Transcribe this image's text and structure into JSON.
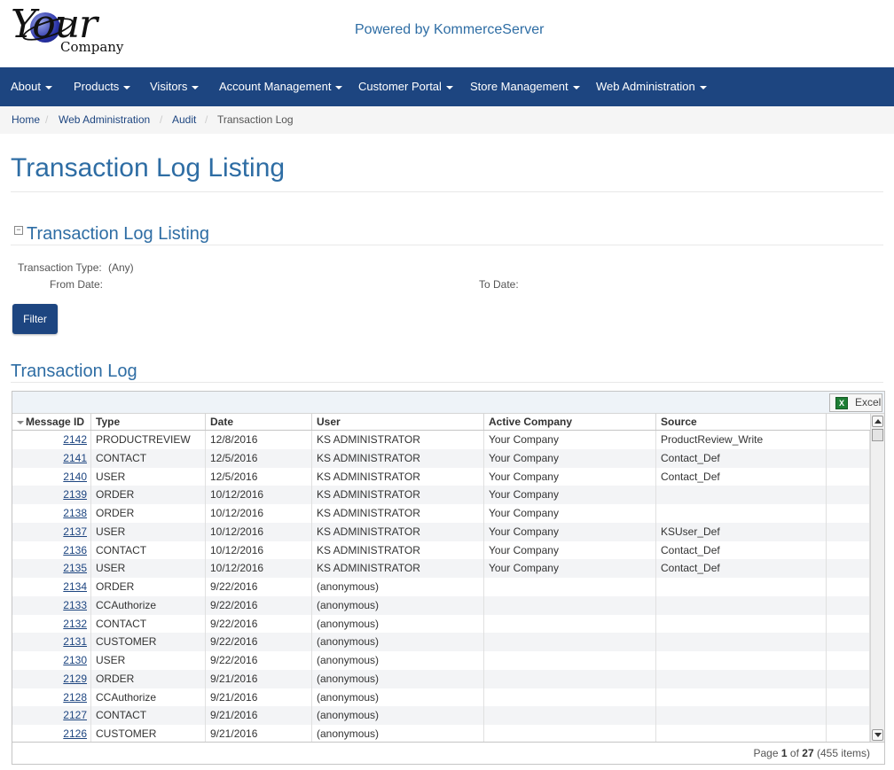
{
  "header": {
    "logo_text": "Your Company",
    "logo_your": "Your",
    "logo_company": "Company",
    "powered_by": "Powered by KommerceServer"
  },
  "nav": {
    "items": [
      {
        "label": "About"
      },
      {
        "label": "Products"
      },
      {
        "label": "Visitors"
      },
      {
        "label": "Account Management"
      },
      {
        "label": "Customer Portal"
      },
      {
        "label": "Store Management"
      },
      {
        "label": "Web Administration"
      }
    ]
  },
  "breadcrumb": {
    "home": "Home",
    "web_admin": "Web Administration",
    "audit": "Audit",
    "current": "Transaction Log",
    "separator": "/"
  },
  "page": {
    "title": "Transaction Log Listing",
    "section_title": "Transaction Log Listing",
    "collapse_glyph": "−"
  },
  "filters": {
    "type_label": "Transaction Type:",
    "type_value": "(Any)",
    "from_label": "From Date:",
    "to_label": "To Date:",
    "filter_button": "Filter"
  },
  "grid": {
    "title": "Transaction Log",
    "excel_label": "Excel",
    "excel_icon": "X",
    "columns": [
      "Message ID",
      "Type",
      "Date",
      "User",
      "Active Company",
      "Source"
    ],
    "rows": [
      [
        "2142",
        "PRODUCTREVIEW",
        "12/8/2016",
        "KS ADMINISTRATOR",
        "Your Company",
        "ProductReview_Write"
      ],
      [
        "2141",
        "CONTACT",
        "12/5/2016",
        "KS ADMINISTRATOR",
        "Your Company",
        "Contact_Def"
      ],
      [
        "2140",
        "USER",
        "12/5/2016",
        "KS ADMINISTRATOR",
        "Your Company",
        "Contact_Def"
      ],
      [
        "2139",
        "ORDER",
        "10/12/2016",
        "KS ADMINISTRATOR",
        "Your Company",
        ""
      ],
      [
        "2138",
        "ORDER",
        "10/12/2016",
        "KS ADMINISTRATOR",
        "Your Company",
        ""
      ],
      [
        "2137",
        "USER",
        "10/12/2016",
        "KS ADMINISTRATOR",
        "Your Company",
        "KSUser_Def"
      ],
      [
        "2136",
        "CONTACT",
        "10/12/2016",
        "KS ADMINISTRATOR",
        "Your Company",
        "Contact_Def"
      ],
      [
        "2135",
        "USER",
        "10/12/2016",
        "KS ADMINISTRATOR",
        "Your Company",
        "Contact_Def"
      ],
      [
        "2134",
        "ORDER",
        "9/22/2016",
        "(anonymous)",
        "",
        ""
      ],
      [
        "2133",
        "CCAuthorize",
        "9/22/2016",
        "(anonymous)",
        "",
        ""
      ],
      [
        "2132",
        "CONTACT",
        "9/22/2016",
        "(anonymous)",
        "",
        ""
      ],
      [
        "2131",
        "CUSTOMER",
        "9/22/2016",
        "(anonymous)",
        "",
        ""
      ],
      [
        "2130",
        "USER",
        "9/22/2016",
        "(anonymous)",
        "",
        ""
      ],
      [
        "2129",
        "ORDER",
        "9/21/2016",
        "(anonymous)",
        "",
        ""
      ],
      [
        "2128",
        "CCAuthorize",
        "9/21/2016",
        "(anonymous)",
        "",
        ""
      ],
      [
        "2127",
        "CONTACT",
        "9/21/2016",
        "(anonymous)",
        "",
        ""
      ],
      [
        "2126",
        "CUSTOMER",
        "9/21/2016",
        "(anonymous)",
        "",
        ""
      ]
    ],
    "pager": {
      "prefix": "Page",
      "current_page": "1",
      "of": "of",
      "total_pages": "27",
      "items": "(455 items)"
    }
  },
  "colors": {
    "nav_bg": "#1d4580",
    "link": "#1d4580",
    "heading": "#2e6da4"
  }
}
